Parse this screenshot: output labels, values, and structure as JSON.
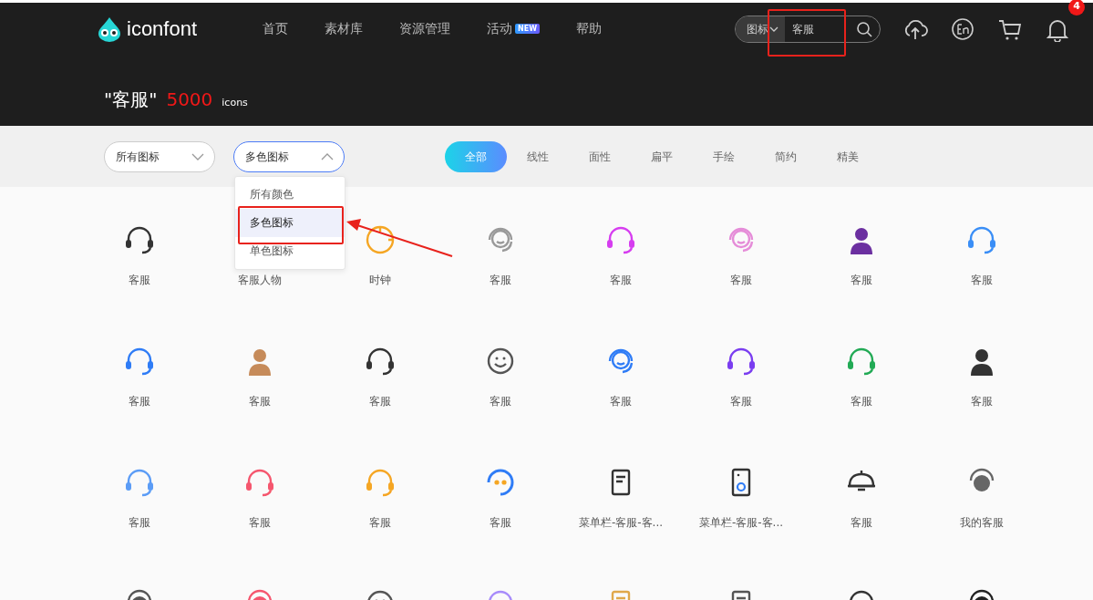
{
  "header": {
    "logo": "iconfont",
    "nav": [
      {
        "label": "首页"
      },
      {
        "label": "素材库"
      },
      {
        "label": "资源管理"
      },
      {
        "label": "活动",
        "badge": "NEW"
      },
      {
        "label": "帮助"
      }
    ],
    "search": {
      "type": "图标",
      "value": "客服",
      "annotated": true
    },
    "notifications": "4"
  },
  "result": {
    "query": "\"客服\"",
    "count": "5000",
    "unit": "icons"
  },
  "filters": {
    "selects": [
      {
        "value": "所有图标",
        "expanded": false
      },
      {
        "value": "多色图标",
        "expanded": true,
        "options": [
          {
            "label": "所有颜色",
            "selected": false,
            "annotated": false
          },
          {
            "label": "多色图标",
            "selected": true,
            "annotated": true
          },
          {
            "label": "单色图标",
            "selected": false,
            "annotated": false
          }
        ]
      }
    ],
    "styles": [
      {
        "label": "全部",
        "selected": true
      },
      {
        "label": "线性",
        "selected": false
      },
      {
        "label": "面性",
        "selected": false
      },
      {
        "label": "扁平",
        "selected": false
      },
      {
        "label": "手绘",
        "selected": false
      },
      {
        "label": "简约",
        "selected": false
      },
      {
        "label": "精美",
        "selected": false
      }
    ]
  },
  "icons": [
    {
      "label": "客服",
      "kind": "headset",
      "color": "#333333"
    },
    {
      "label": "客服人物"
    },
    {
      "label": "时钟",
      "kind": "clock",
      "color": "#f5a623"
    },
    {
      "label": "客服",
      "kind": "face",
      "color": "#999999"
    },
    {
      "label": "客服",
      "kind": "headset",
      "color": "#d63df0"
    },
    {
      "label": "客服",
      "kind": "face",
      "color": "#e58cd8"
    },
    {
      "label": "客服",
      "kind": "person",
      "color": "#6b2fa0"
    },
    {
      "label": "客服",
      "kind": "headset",
      "color": "#3a8ef6"
    },
    {
      "label": "客服",
      "kind": "headset",
      "color": "#2f7cf6"
    },
    {
      "label": "客服",
      "kind": "person",
      "color": "#c68b5a"
    },
    {
      "label": "客服",
      "kind": "headset",
      "color": "#333333"
    },
    {
      "label": "客服",
      "kind": "smile",
      "color": "#555555"
    },
    {
      "label": "客服",
      "kind": "face",
      "color": "#2f7cf6"
    },
    {
      "label": "客服",
      "kind": "headset",
      "color": "#7a3df0"
    },
    {
      "label": "客服",
      "kind": "headset",
      "color": "#22aa55"
    },
    {
      "label": "客服",
      "kind": "person",
      "color": "#333333"
    },
    {
      "label": "客服",
      "kind": "headset",
      "color": "#5b9cf6"
    },
    {
      "label": "客服",
      "kind": "headset",
      "color": "#f5566e"
    },
    {
      "label": "客服",
      "kind": "headset",
      "color": "#f5a623"
    },
    {
      "label": "客服",
      "kind": "robot",
      "color": "#2f7cf6"
    },
    {
      "label": "菜单栏-客服-客...",
      "kind": "document",
      "color": "#333333"
    },
    {
      "label": "菜单栏-客服-客...",
      "kind": "speaker",
      "color": "#333333"
    },
    {
      "label": "客服",
      "kind": "bell",
      "color": "#333333"
    },
    {
      "label": "我的客服",
      "kind": "dot",
      "color": "#666666"
    },
    {
      "kind": "dot",
      "color": "#555555"
    },
    {
      "kind": "dot",
      "color": "#f5566e"
    },
    {
      "kind": "smile",
      "color": "#555555"
    },
    {
      "kind": "headset",
      "color": "#a78bfa"
    },
    {
      "kind": "document",
      "color": "#e0a84a"
    },
    {
      "kind": "document",
      "color": "#555555"
    },
    {
      "kind": "headset",
      "color": "#333333"
    },
    {
      "kind": "dot",
      "color": "#222222"
    }
  ]
}
